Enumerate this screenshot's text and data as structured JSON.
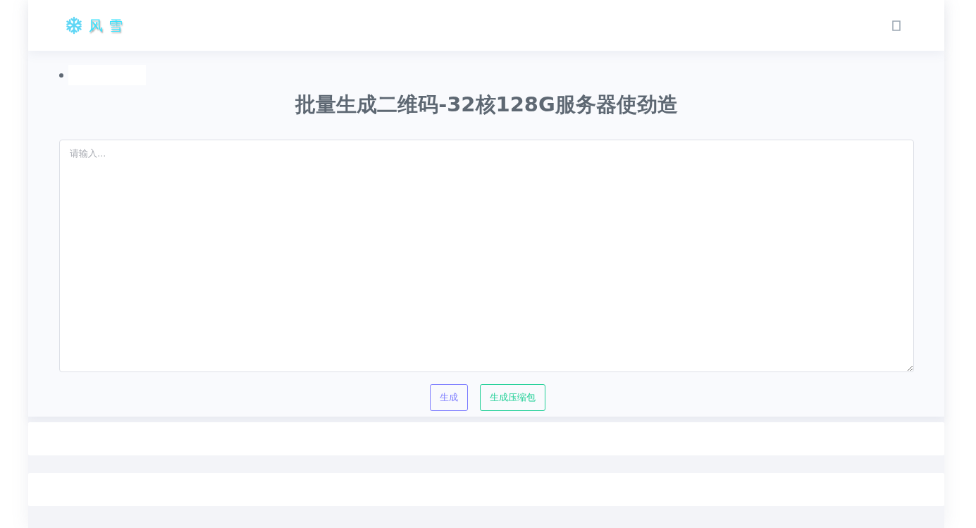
{
  "header": {
    "logo_text": "风 雪"
  },
  "title": "批量生成二维码-32核128G服务器使劲造",
  "input": {
    "placeholder": "请输入..."
  },
  "buttons": [
    {
      "label": "生成",
      "kind": "primary"
    },
    {
      "label": "生成压缩包",
      "kind": "success"
    }
  ]
}
